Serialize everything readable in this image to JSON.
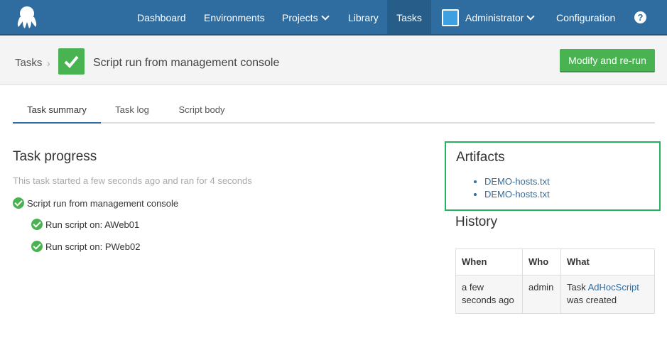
{
  "nav": {
    "items": [
      "Dashboard",
      "Environments",
      "Projects",
      "Library",
      "Tasks",
      "Administrator",
      "Configuration"
    ],
    "help": "?"
  },
  "titlebar": {
    "crumb": "Tasks",
    "sep": "›",
    "title": "Script run from management console",
    "button": "Modify and re-run"
  },
  "tabs": [
    "Task summary",
    "Task log",
    "Script body"
  ],
  "progress": {
    "heading": "Task progress",
    "summary": "This task started a few seconds ago and ran for 4 seconds",
    "root": "Script run from management console",
    "steps": [
      "Run script on: AWeb01",
      "Run script on: PWeb02"
    ]
  },
  "artifacts": {
    "heading": "Artifacts",
    "files": [
      "DEMO-hosts.txt",
      "DEMO-hosts.txt"
    ]
  },
  "history": {
    "heading": "History",
    "columns": [
      "When",
      "Who",
      "What"
    ],
    "rows": [
      {
        "when_1": "a few",
        "when_2": "seconds ago",
        "who": "admin",
        "what_pre": "Task",
        "what_link": "AdHocScript",
        "what_post": "was created"
      }
    ]
  },
  "colors": {
    "nav": "#2f6da1",
    "success": "#48b350",
    "link": "#2f6da1",
    "highlight": "#27b35e"
  }
}
